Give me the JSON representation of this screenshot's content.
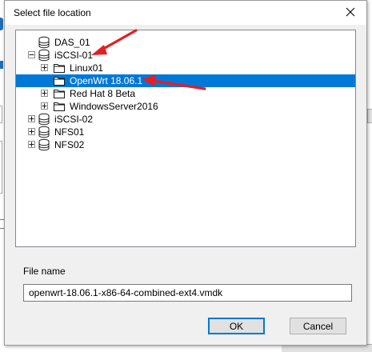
{
  "dialog": {
    "title": "Select file location",
    "close_label": "✕"
  },
  "tree": {
    "items": [
      {
        "label": "DAS_01",
        "icon": "datastore-icon",
        "expander": "none",
        "selected": false
      },
      {
        "label": "iSCSI-01",
        "icon": "datastore-icon",
        "expander": "collapse",
        "selected": false
      },
      {
        "label": "Linux01",
        "icon": "folder-icon",
        "expander": "expand",
        "selected": false
      },
      {
        "label": "OpenWrt 18.06.1",
        "icon": "folder-icon",
        "expander": "none",
        "selected": true
      },
      {
        "label": "Red Hat 8 Beta",
        "icon": "folder-icon",
        "expander": "expand",
        "selected": false
      },
      {
        "label": "WindowsServer2016",
        "icon": "folder-icon",
        "expander": "expand",
        "selected": false
      },
      {
        "label": "iSCSI-02",
        "icon": "datastore-icon",
        "expander": "expand",
        "selected": false
      },
      {
        "label": "NFS01",
        "icon": "datastore-icon",
        "expander": "expand",
        "selected": false
      },
      {
        "label": "NFS02",
        "icon": "datastore-icon",
        "expander": "expand",
        "selected": false
      }
    ]
  },
  "file_name": {
    "label": "File name",
    "value": "openwrt-18.06.1-x86-64-combined-ext4.vmdk"
  },
  "buttons": {
    "ok": "OK",
    "cancel": "Cancel"
  },
  "background": {
    "right_text": "..."
  },
  "colors": {
    "selection": "#0078d7",
    "annotation_arrow": "#e31e24",
    "dialog_bg": "#f0f0f0"
  }
}
